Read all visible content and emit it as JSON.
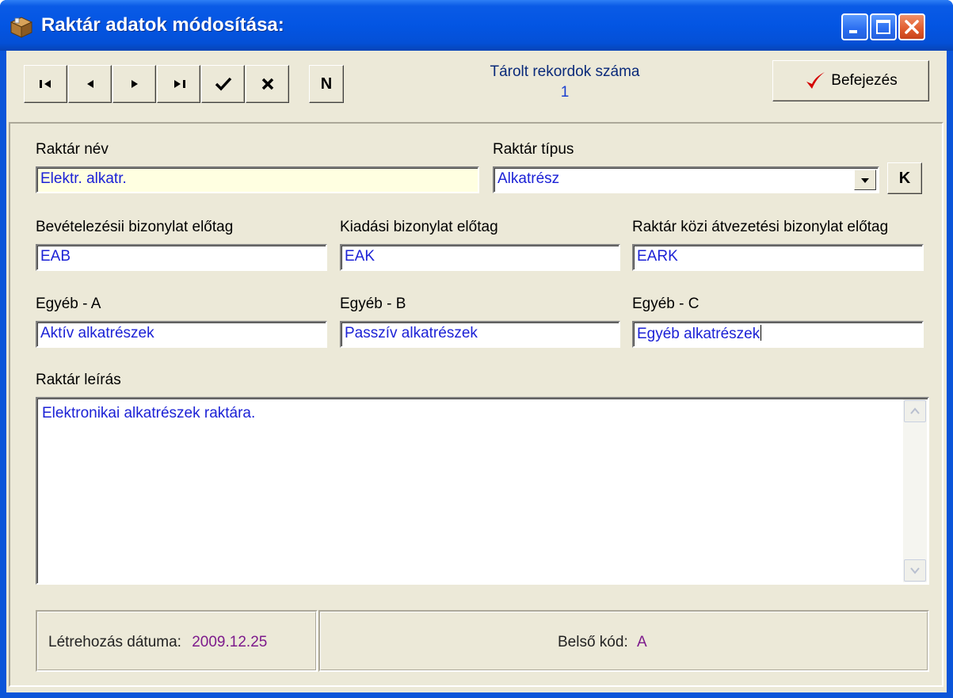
{
  "window": {
    "title": "Raktár adatok módosítása:"
  },
  "toolbar": {
    "nav_buttons": [
      {
        "name": "first-record-button",
        "glyph": "I◀"
      },
      {
        "name": "prev-record-button",
        "glyph": "◀"
      },
      {
        "name": "next-record-button",
        "glyph": "▶"
      },
      {
        "name": "last-record-button",
        "glyph": "▶I"
      },
      {
        "name": "post-button",
        "glyph": "✔"
      },
      {
        "name": "cancel-button",
        "glyph": "✕"
      }
    ],
    "new_label": "N",
    "stored_records_label": "Tárolt rekordok száma",
    "stored_records_value": "1",
    "finish_label": "Befejezés"
  },
  "form": {
    "warehouse_name": {
      "label": "Raktár név",
      "value": "Elektr. alkatr."
    },
    "warehouse_type": {
      "label": "Raktár típus",
      "value": "Alkatrész",
      "k_label": "K"
    },
    "receipt_prefix": {
      "label": "Bevételezésii bizonylat előtag",
      "value": "EAB"
    },
    "issue_prefix": {
      "label": "Kiadási bizonylat előtag",
      "value": "EAK"
    },
    "transfer_prefix": {
      "label": "Raktár közi átvezetési bizonylat előtag",
      "value": "EARK"
    },
    "other_a": {
      "label": "Egyéb - A",
      "value": "Aktív alkatrészek"
    },
    "other_b": {
      "label": "Egyéb - B",
      "value": "Passzív alkatrészek"
    },
    "other_c": {
      "label": "Egyéb - C",
      "value": "Egyéb alkatrészek"
    },
    "description": {
      "label": "Raktár leírás",
      "value": "Elektronikai alkatrészek raktára."
    }
  },
  "status": {
    "created_label": "Létrehozás dátuma:",
    "created_value": "2009.12.25",
    "internal_code_label": "Belső kód:",
    "internal_code_value": "A"
  },
  "colors": {
    "title_bar": "#0355e3",
    "field_text": "#1c22d6",
    "status_value": "#7d1a8c",
    "finish_check": "#d40000"
  }
}
